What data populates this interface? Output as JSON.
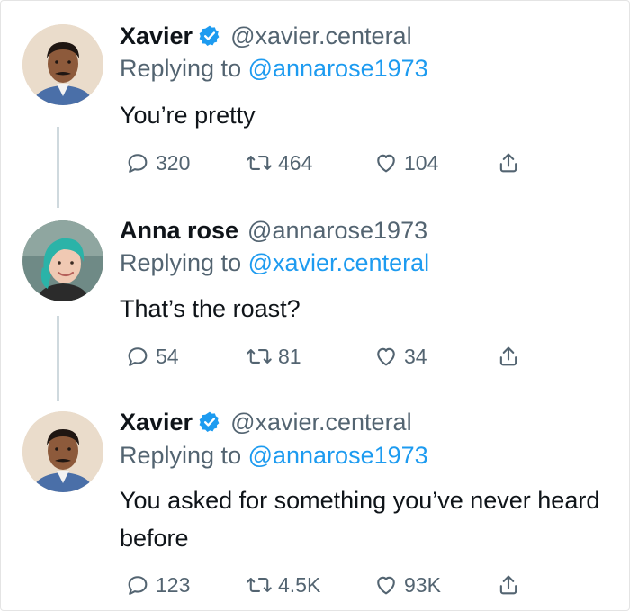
{
  "tweets": [
    {
      "name": "Xavier",
      "verified": true,
      "handle": "@xavier.centeral",
      "replying_prefix": "Replying to ",
      "replying_to": "@annarose1973",
      "text": "You’re pretty",
      "replies": "320",
      "retweets": "464",
      "likes": "104"
    },
    {
      "name": "Anna rose",
      "verified": false,
      "handle": "@annarose1973",
      "replying_prefix": "Replying to ",
      "replying_to": "@xavier.centeral",
      "text": "That’s the roast?",
      "replies": "54",
      "retweets": "81",
      "likes": "34"
    },
    {
      "name": "Xavier",
      "verified": true,
      "handle": "@xavier.centeral",
      "replying_prefix": "Replying to ",
      "replying_to": "@annarose1973",
      "text": "You asked for something you’ve never heard before",
      "replies": "123",
      "retweets": "4.5K",
      "likes": "93K"
    }
  ],
  "colors": {
    "link": "#1d9bf0",
    "secondary_text": "#536471",
    "verified_badge": "#1d9bf0"
  },
  "icons": [
    "reply-icon",
    "retweet-icon",
    "like-icon",
    "share-icon",
    "verified-badge-icon"
  ]
}
